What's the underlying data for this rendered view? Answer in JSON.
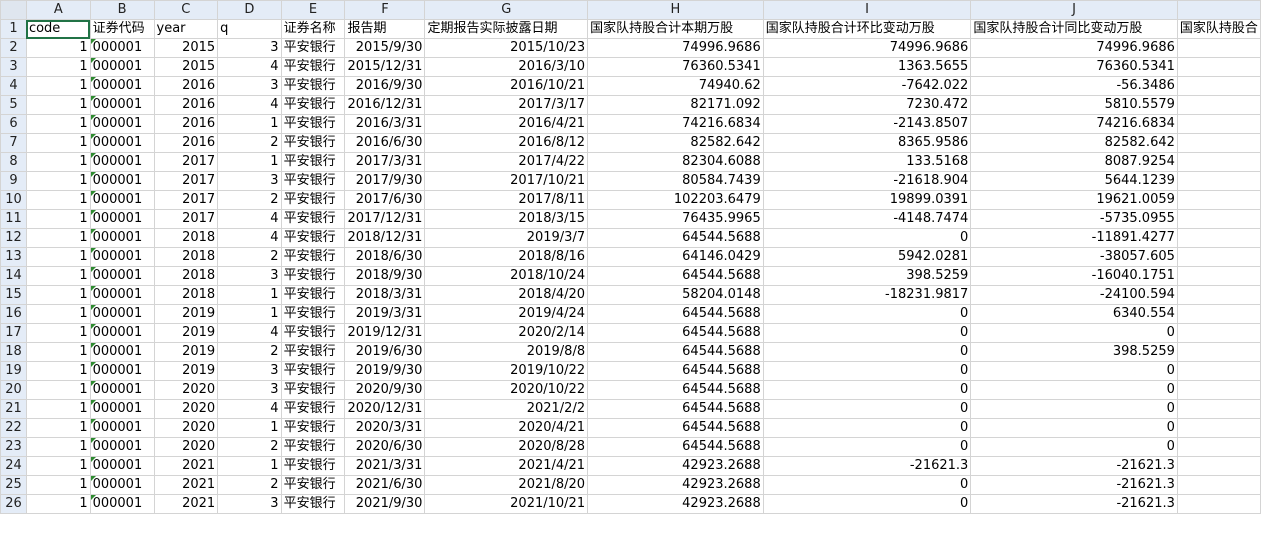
{
  "columns": [
    "A",
    "B",
    "C",
    "D",
    "E",
    "F",
    "G",
    "H",
    "I",
    "J",
    ""
  ],
  "header_row": {
    "row_num": "1",
    "cells": [
      "code",
      "证券代码",
      "year",
      "q",
      "证券名称",
      "报告期",
      "定期报告实际披露日期",
      "国家队持股合计本期万股",
      "国家队持股合计环比变动万股",
      "国家队持股合计同比变动万股",
      "国家队持股合"
    ]
  },
  "rows": [
    {
      "n": "2",
      "a": "1",
      "b": "000001",
      "c": "2015",
      "d": "3",
      "e": "平安银行",
      "f": "2015/9/30",
      "g": "2015/10/23",
      "h": "74996.9686",
      "i": "74996.9686",
      "j": "74996.9686"
    },
    {
      "n": "3",
      "a": "1",
      "b": "000001",
      "c": "2015",
      "d": "4",
      "e": "平安银行",
      "f": "2015/12/31",
      "g": "2016/3/10",
      "h": "76360.5341",
      "i": "1363.5655",
      "j": "76360.5341"
    },
    {
      "n": "4",
      "a": "1",
      "b": "000001",
      "c": "2016",
      "d": "3",
      "e": "平安银行",
      "f": "2016/9/30",
      "g": "2016/10/21",
      "h": "74940.62",
      "i": "-7642.022",
      "j": "-56.3486"
    },
    {
      "n": "5",
      "a": "1",
      "b": "000001",
      "c": "2016",
      "d": "4",
      "e": "平安银行",
      "f": "2016/12/31",
      "g": "2017/3/17",
      "h": "82171.092",
      "i": "7230.472",
      "j": "5810.5579"
    },
    {
      "n": "6",
      "a": "1",
      "b": "000001",
      "c": "2016",
      "d": "1",
      "e": "平安银行",
      "f": "2016/3/31",
      "g": "2016/4/21",
      "h": "74216.6834",
      "i": "-2143.8507",
      "j": "74216.6834"
    },
    {
      "n": "7",
      "a": "1",
      "b": "000001",
      "c": "2016",
      "d": "2",
      "e": "平安银行",
      "f": "2016/6/30",
      "g": "2016/8/12",
      "h": "82582.642",
      "i": "8365.9586",
      "j": "82582.642"
    },
    {
      "n": "8",
      "a": "1",
      "b": "000001",
      "c": "2017",
      "d": "1",
      "e": "平安银行",
      "f": "2017/3/31",
      "g": "2017/4/22",
      "h": "82304.6088",
      "i": "133.5168",
      "j": "8087.9254"
    },
    {
      "n": "9",
      "a": "1",
      "b": "000001",
      "c": "2017",
      "d": "3",
      "e": "平安银行",
      "f": "2017/9/30",
      "g": "2017/10/21",
      "h": "80584.7439",
      "i": "-21618.904",
      "j": "5644.1239"
    },
    {
      "n": "10",
      "a": "1",
      "b": "000001",
      "c": "2017",
      "d": "2",
      "e": "平安银行",
      "f": "2017/6/30",
      "g": "2017/8/11",
      "h": "102203.6479",
      "i": "19899.0391",
      "j": "19621.0059"
    },
    {
      "n": "11",
      "a": "1",
      "b": "000001",
      "c": "2017",
      "d": "4",
      "e": "平安银行",
      "f": "2017/12/31",
      "g": "2018/3/15",
      "h": "76435.9965",
      "i": "-4148.7474",
      "j": "-5735.0955"
    },
    {
      "n": "12",
      "a": "1",
      "b": "000001",
      "c": "2018",
      "d": "4",
      "e": "平安银行",
      "f": "2018/12/31",
      "g": "2019/3/7",
      "h": "64544.5688",
      "i": "0",
      "j": "-11891.4277"
    },
    {
      "n": "13",
      "a": "1",
      "b": "000001",
      "c": "2018",
      "d": "2",
      "e": "平安银行",
      "f": "2018/6/30",
      "g": "2018/8/16",
      "h": "64146.0429",
      "i": "5942.0281",
      "j": "-38057.605"
    },
    {
      "n": "14",
      "a": "1",
      "b": "000001",
      "c": "2018",
      "d": "3",
      "e": "平安银行",
      "f": "2018/9/30",
      "g": "2018/10/24",
      "h": "64544.5688",
      "i": "398.5259",
      "j": "-16040.1751"
    },
    {
      "n": "15",
      "a": "1",
      "b": "000001",
      "c": "2018",
      "d": "1",
      "e": "平安银行",
      "f": "2018/3/31",
      "g": "2018/4/20",
      "h": "58204.0148",
      "i": "-18231.9817",
      "j": "-24100.594"
    },
    {
      "n": "16",
      "a": "1",
      "b": "000001",
      "c": "2019",
      "d": "1",
      "e": "平安银行",
      "f": "2019/3/31",
      "g": "2019/4/24",
      "h": "64544.5688",
      "i": "0",
      "j": "6340.554"
    },
    {
      "n": "17",
      "a": "1",
      "b": "000001",
      "c": "2019",
      "d": "4",
      "e": "平安银行",
      "f": "2019/12/31",
      "g": "2020/2/14",
      "h": "64544.5688",
      "i": "0",
      "j": "0"
    },
    {
      "n": "18",
      "a": "1",
      "b": "000001",
      "c": "2019",
      "d": "2",
      "e": "平安银行",
      "f": "2019/6/30",
      "g": "2019/8/8",
      "h": "64544.5688",
      "i": "0",
      "j": "398.5259"
    },
    {
      "n": "19",
      "a": "1",
      "b": "000001",
      "c": "2019",
      "d": "3",
      "e": "平安银行",
      "f": "2019/9/30",
      "g": "2019/10/22",
      "h": "64544.5688",
      "i": "0",
      "j": "0"
    },
    {
      "n": "20",
      "a": "1",
      "b": "000001",
      "c": "2020",
      "d": "3",
      "e": "平安银行",
      "f": "2020/9/30",
      "g": "2020/10/22",
      "h": "64544.5688",
      "i": "0",
      "j": "0"
    },
    {
      "n": "21",
      "a": "1",
      "b": "000001",
      "c": "2020",
      "d": "4",
      "e": "平安银行",
      "f": "2020/12/31",
      "g": "2021/2/2",
      "h": "64544.5688",
      "i": "0",
      "j": "0"
    },
    {
      "n": "22",
      "a": "1",
      "b": "000001",
      "c": "2020",
      "d": "1",
      "e": "平安银行",
      "f": "2020/3/31",
      "g": "2020/4/21",
      "h": "64544.5688",
      "i": "0",
      "j": "0"
    },
    {
      "n": "23",
      "a": "1",
      "b": "000001",
      "c": "2020",
      "d": "2",
      "e": "平安银行",
      "f": "2020/6/30",
      "g": "2020/8/28",
      "h": "64544.5688",
      "i": "0",
      "j": "0"
    },
    {
      "n": "24",
      "a": "1",
      "b": "000001",
      "c": "2021",
      "d": "1",
      "e": "平安银行",
      "f": "2021/3/31",
      "g": "2021/4/21",
      "h": "42923.2688",
      "i": "-21621.3",
      "j": "-21621.3"
    },
    {
      "n": "25",
      "a": "1",
      "b": "000001",
      "c": "2021",
      "d": "2",
      "e": "平安银行",
      "f": "2021/6/30",
      "g": "2021/8/20",
      "h": "42923.2688",
      "i": "0",
      "j": "-21621.3"
    },
    {
      "n": "26",
      "a": "1",
      "b": "000001",
      "c": "2021",
      "d": "3",
      "e": "平安银行",
      "f": "2021/9/30",
      "g": "2021/10/21",
      "h": "42923.2688",
      "i": "0",
      "j": "-21621.3"
    }
  ],
  "colors": {
    "header_bg": "#e4ecf7",
    "gridline": "#d4d4d4",
    "text_indicator": "#2e8b30",
    "selection": "#217346"
  }
}
